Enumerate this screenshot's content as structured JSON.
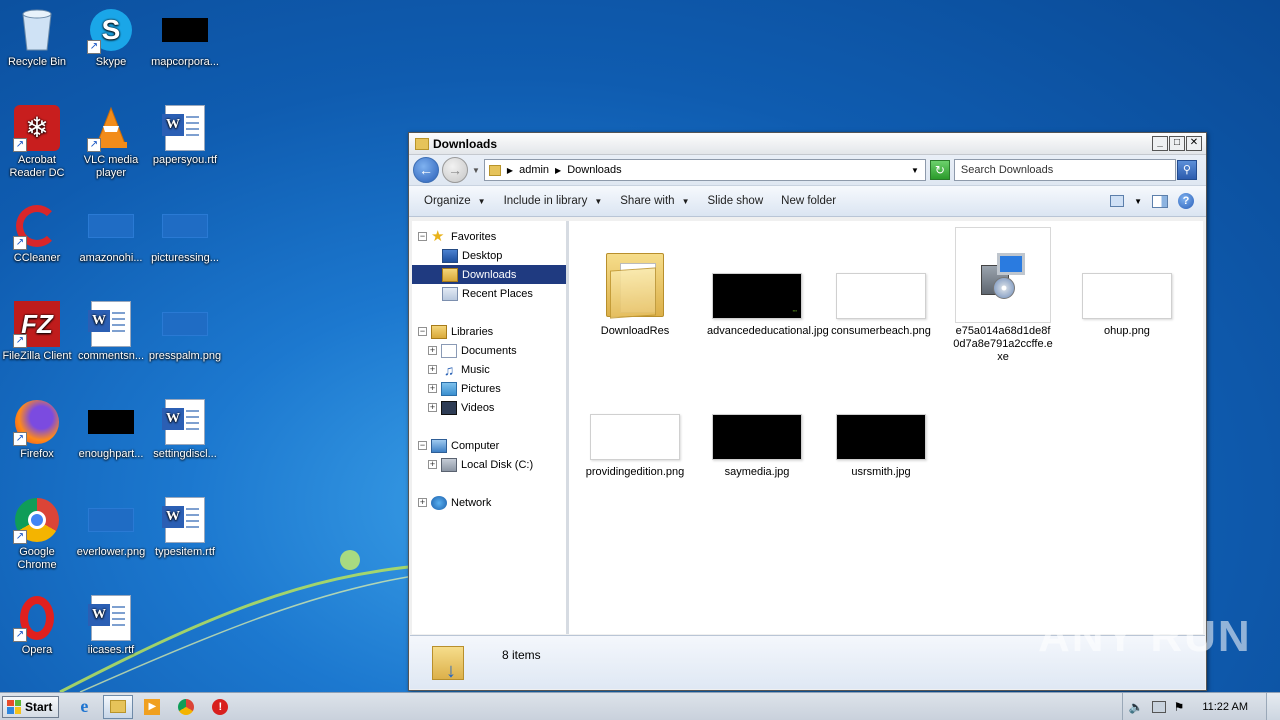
{
  "desktop": {
    "icons": [
      {
        "label": "Recycle Bin"
      },
      {
        "label": "Skype"
      },
      {
        "label": "mapcorpora..."
      },
      {
        "label": "Acrobat Reader DC"
      },
      {
        "label": "VLC media player"
      },
      {
        "label": "papersyou.rtf"
      },
      {
        "label": "CCleaner"
      },
      {
        "label": "amazonohi..."
      },
      {
        "label": "picturessing..."
      },
      {
        "label": "FileZilla Client"
      },
      {
        "label": "commentsn..."
      },
      {
        "label": "presspalm.png"
      },
      {
        "label": "Firefox"
      },
      {
        "label": "enoughpart..."
      },
      {
        "label": "settingdiscl..."
      },
      {
        "label": "Google Chrome"
      },
      {
        "label": "everlower.png"
      },
      {
        "label": "typesitem.rtf"
      },
      {
        "label": "Opera"
      },
      {
        "label": "iicases.rtf"
      }
    ]
  },
  "window": {
    "title": "Downloads",
    "address": {
      "crumbs": [
        "admin",
        "Downloads"
      ]
    },
    "search_placeholder": "Search Downloads",
    "toolbar": {
      "organize": "Organize",
      "include_in_library": "Include in library",
      "share_with": "Share with",
      "slide_show": "Slide show",
      "new_folder": "New folder"
    },
    "nav": {
      "favorites": "Favorites",
      "desktop": "Desktop",
      "downloads": "Downloads",
      "recent_places": "Recent Places",
      "libraries": "Libraries",
      "documents": "Documents",
      "music": "Music",
      "pictures": "Pictures",
      "videos": "Videos",
      "computer": "Computer",
      "local_disk": "Local Disk (C:)",
      "network": "Network"
    },
    "files": [
      {
        "name": "DownloadRes"
      },
      {
        "name": "advancededucational.jpg"
      },
      {
        "name": "consumerbeach.png"
      },
      {
        "name": "e75a014a68d1de8f0d7a8e791a2ccffe.exe"
      },
      {
        "name": "ohup.png"
      },
      {
        "name": "providingedition.png"
      },
      {
        "name": "saymedia.jpg"
      },
      {
        "name": "usrsmith.jpg"
      }
    ],
    "status": "8 items"
  },
  "taskbar": {
    "start_label": "Start",
    "clock": "11:22 AM"
  },
  "watermark": "ANY RUN"
}
